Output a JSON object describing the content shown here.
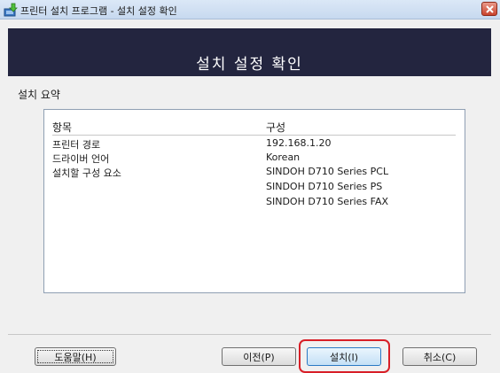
{
  "window": {
    "title": "프린터 설치 프로그램 - 설치 설정 확인"
  },
  "header": {
    "title": "설치 설정 확인"
  },
  "summary": {
    "label": "설치 요약",
    "columns": [
      "항목",
      "구성"
    ],
    "rows": [
      {
        "item": "프린터 경로",
        "value": "192.168.1.20"
      },
      {
        "item": "드라이버 언어",
        "value": "Korean"
      },
      {
        "item": "설치할 구성 요소",
        "value": "SINDOH D710 Series PCL"
      },
      {
        "item": "",
        "value": "SINDOH D710 Series PS"
      },
      {
        "item": "",
        "value": "SINDOH D710 Series FAX"
      }
    ]
  },
  "buttons": {
    "help": "도움말(H)",
    "prev": "이전(P)",
    "install": "설치(I)",
    "cancel": "취소(C)"
  },
  "colors": {
    "header_bg": "#23253f",
    "highlight": "#d81f27"
  }
}
